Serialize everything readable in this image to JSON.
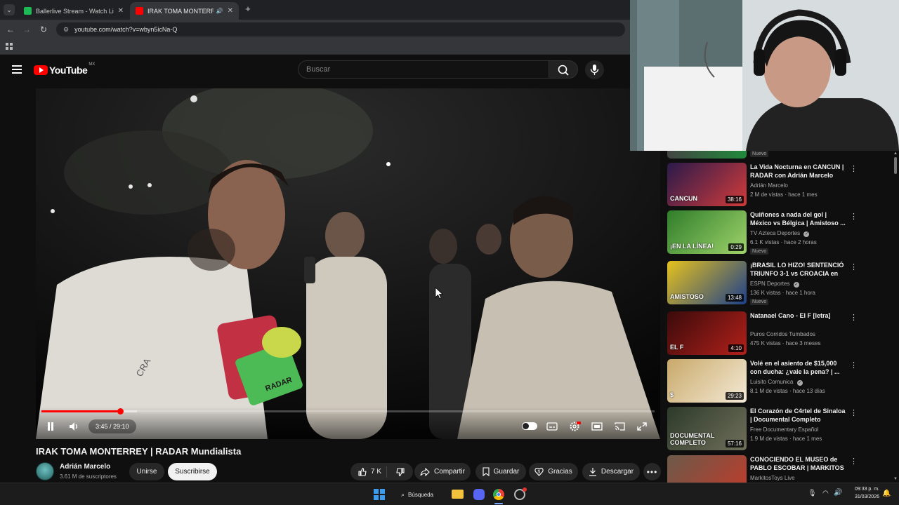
{
  "browser": {
    "tabs": [
      {
        "title": "Ballerlive Stream - Watch Live",
        "favicon": "ballerlive-icon",
        "color": "#1db954"
      },
      {
        "title": "IRAK TOMA MONTERREY | R",
        "favicon": "youtube-icon",
        "color": "#ff0000"
      }
    ],
    "url": "youtube.com/watch?v=wbyn5icNa-Q"
  },
  "youtube": {
    "logo_text": "YouTube",
    "region": "MX",
    "search_placeholder": "Buscar"
  },
  "player": {
    "time": "3:45 / 29:10",
    "progress_fraction": 0.1286,
    "mic_flag_text": "RADAR",
    "shirt_text": "CRA"
  },
  "video": {
    "title": "IRAK TOMA MONTERREY | RADAR Mundialista",
    "channel": "Adrián Marcelo",
    "subscribers": "3.61 M de suscriptores",
    "join_label": "Unirse",
    "subscribe_label": "Suscribirse",
    "likes": "7 K",
    "share_label": "Compartir",
    "save_label": "Guardar",
    "thanks_label": "Gracias",
    "download_label": "Descargar"
  },
  "sidebar": {
    "partial_top_badge": "Nuevo",
    "items": [
      {
        "title": "La Vida Nocturna en CANCUN | RADAR con Adrián Marcelo",
        "channel": "Adrián Marcelo",
        "meta": "2 M de vistas · hace 1 mes",
        "duration": "38:16",
        "badge": "",
        "verified": false,
        "thumb_text": "CANCUN",
        "colors": [
          "#2a1a4a",
          "#d23b3b"
        ]
      },
      {
        "title": "Quiñones a nada del gol | México vs Bélgica | Amistoso ...",
        "channel": "TV Azteca Deportes",
        "meta": "6.1 K vistas · hace 2 horas",
        "duration": "0:29",
        "badge": "Nuevo",
        "verified": true,
        "thumb_text": "¡EN LA LÍNEA!",
        "colors": [
          "#2f7d2a",
          "#9fd36b"
        ]
      },
      {
        "title": "¡BRASIL LO HIZO! SENTENCIÓ TRIUNFO 3-1 vs CROACIA en a...",
        "channel": "ESPN Deportes",
        "meta": "136 K vistas · hace 1 hora",
        "duration": "13:48",
        "badge": "Nuevo",
        "verified": true,
        "thumb_text": "AMISTOSO",
        "colors": [
          "#e6c21d",
          "#1d3f8a"
        ]
      },
      {
        "title": "Natanael Cano - El F [letra]",
        "channel": "Puros Corridos Tumbados",
        "meta": "475 K vistas · hace 3 meses",
        "duration": "4:10",
        "badge": "",
        "verified": false,
        "thumb_text": "EL F",
        "colors": [
          "#3a0b0b",
          "#b3201a"
        ]
      },
      {
        "title": "Volé en el asiento de $15,000 con ducha: ¿vale la pena? | ...",
        "channel": "Luisito Comunica",
        "meta": "8.1 M de vistas · hace 13 días",
        "duration": "29:23",
        "badge": "",
        "verified": true,
        "thumb_text": "$",
        "colors": [
          "#c9a96a",
          "#f4ead6"
        ]
      },
      {
        "title": "El Corazón de C4rtel de Sinaloa | Documental Completo",
        "channel": "Free Documentary Español",
        "meta": "1.9 M de vistas · hace 1 mes",
        "duration": "57:16",
        "badge": "",
        "verified": false,
        "thumb_text": "DOCUMENTAL COMPLETO",
        "colors": [
          "#2d3a2a",
          "#6f6f5a"
        ]
      },
      {
        "title": "CONOCIENDO EL MUSEO de PABLO ESCOBAR | MARKITOS ...",
        "channel": "MarkitosToys Live",
        "meta": "",
        "duration": "",
        "badge": "",
        "verified": false,
        "thumb_text": "",
        "colors": [
          "#6b5a4a",
          "#c23a2a"
        ]
      }
    ]
  },
  "taskbar": {
    "search_label": "Búsqueda",
    "time": "09:33 p. m.",
    "date": "31/03/2026"
  }
}
